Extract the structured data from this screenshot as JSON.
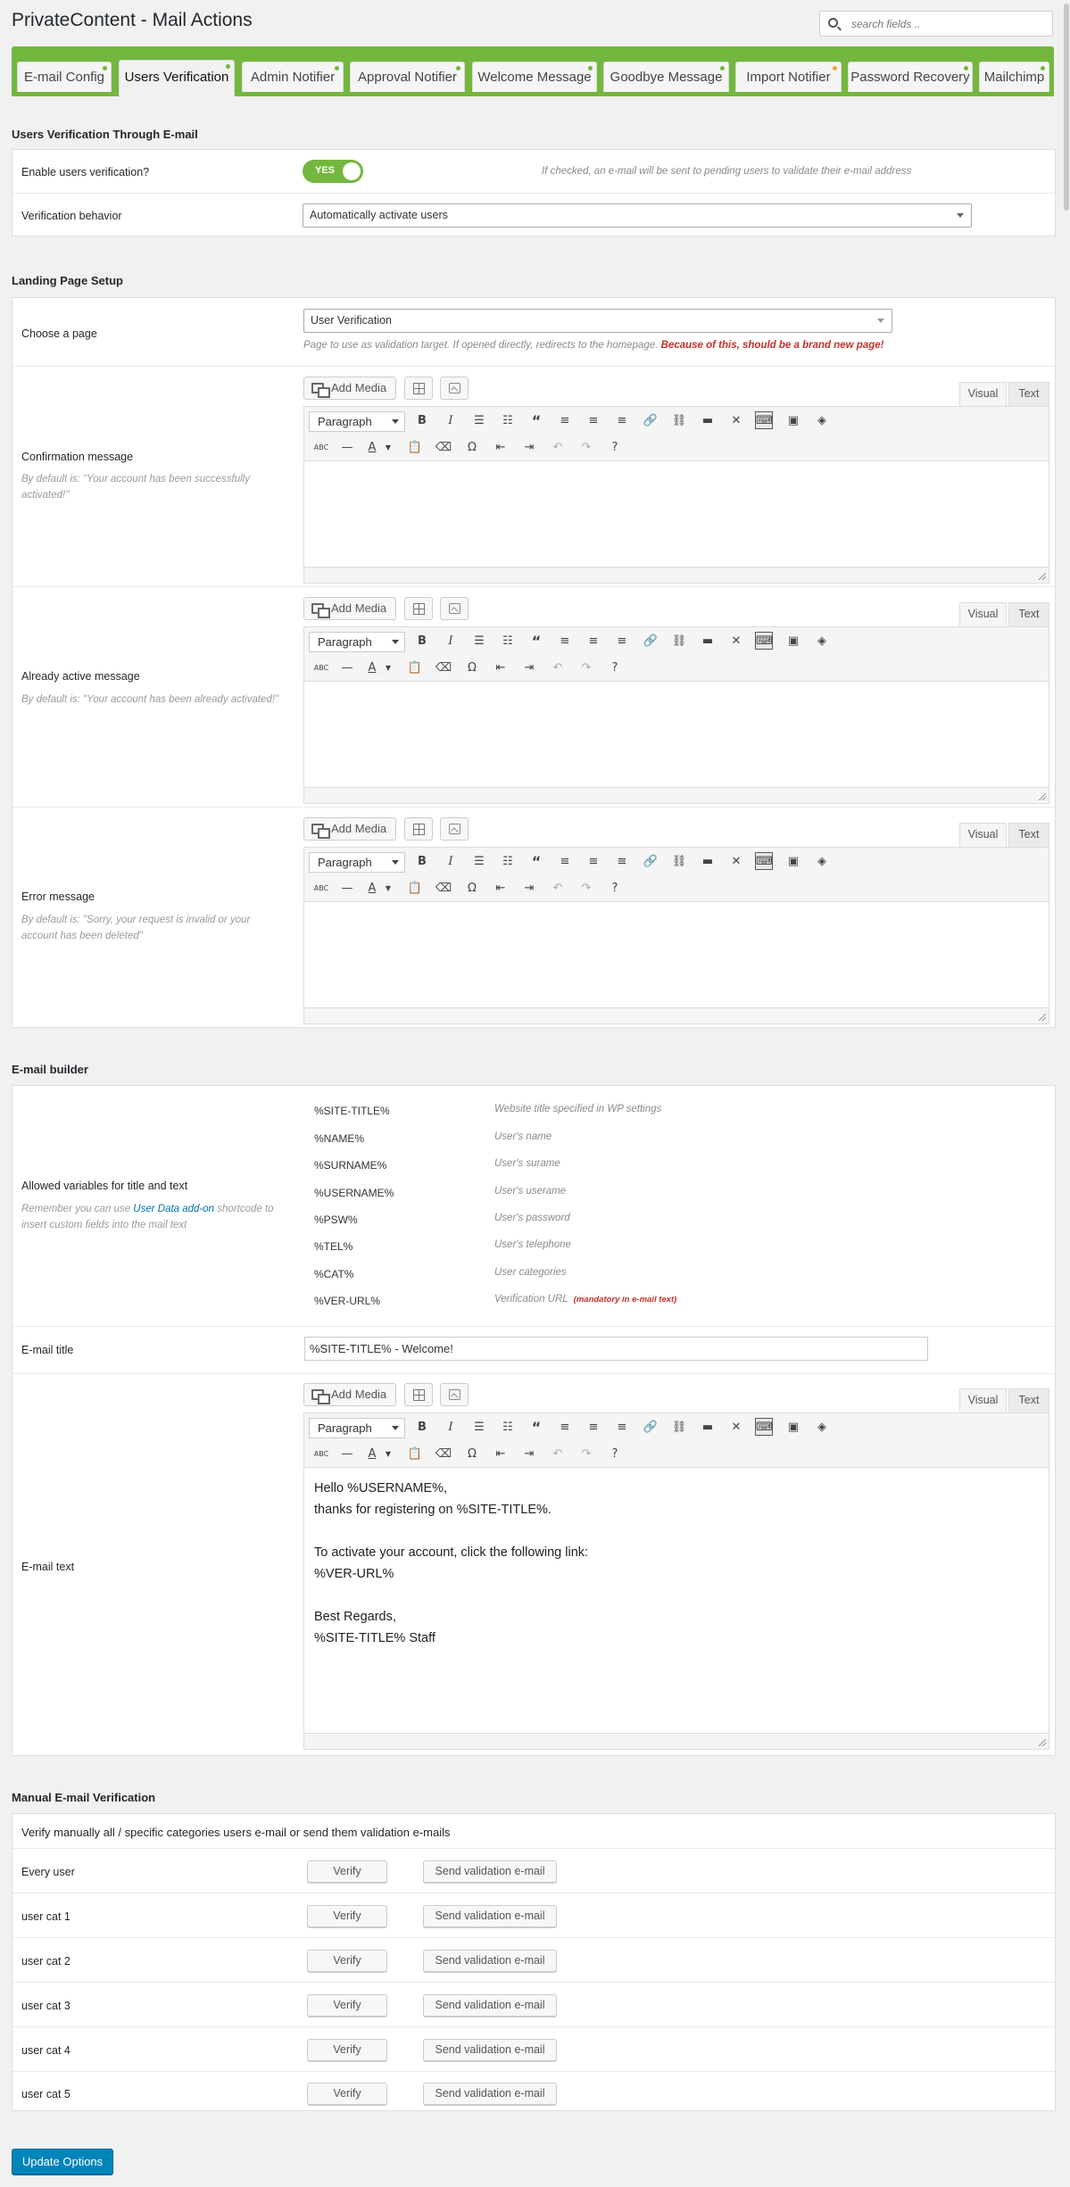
{
  "header": {
    "title": "PrivateContent - Mail Actions",
    "search_placeholder": "search fields .."
  },
  "tabs": [
    {
      "label": "E-mail Config"
    },
    {
      "label": "Users Verification"
    },
    {
      "label": "Admin Notifier"
    },
    {
      "label": "Approval Notifier"
    },
    {
      "label": "Welcome Message"
    },
    {
      "label": "Goodbye Message"
    },
    {
      "label": "Import Notifier"
    },
    {
      "label": "Password Recovery"
    },
    {
      "label": "Mailchimp"
    }
  ],
  "colors": {
    "tab_bar": "#73b73e",
    "toggle_on": "#73b73e",
    "warning_red": "#c4302b",
    "primary_button": "#0085ba",
    "link": "#0073aa"
  },
  "verification": {
    "title": "Users Verification Through E-mail",
    "enable_label": "Enable users verification?",
    "enable_toggle": "YES",
    "enable_note": "If checked, an e-mail will be sent to pending users to validate their e-mail address",
    "behavior_label": "Verification behavior",
    "behavior_value": "Automatically activate users"
  },
  "landing": {
    "title": "Landing Page Setup",
    "page_label": "Choose a page",
    "page_value": "User Verification",
    "page_note": "Page to use as validation target. If opened directly, redirects to the homepage.",
    "page_warning": "Because of this, should be a brand new page!",
    "confirm_label": "Confirmation message",
    "confirm_hint": "By default is: \"Your account has been successfully activated!\"",
    "active_label": "Already active message",
    "active_hint": "By default is: \"Your account has been already activated!\"",
    "error_label": "Error message",
    "error_hint": "By default is: \"Sorry, your request is invalid or your account has been deleted\""
  },
  "editor": {
    "add_media": "Add Media",
    "paragraph": "Paragraph",
    "visual": "Visual",
    "text": "Text"
  },
  "builder": {
    "title": "E-mail builder",
    "vars_label": "Allowed variables for title and text",
    "vars_hint_pre": "Remember you can use",
    "vars_hint_link": "User Data add-on",
    "vars_hint_post": "shortcode to insert custom fields into the mail text",
    "variables": [
      {
        "name": "%SITE-TITLE%",
        "desc": "Website title specified in WP settings"
      },
      {
        "name": "%NAME%",
        "desc": "User's name"
      },
      {
        "name": "%SURNAME%",
        "desc": "User's surame"
      },
      {
        "name": "%USERNAME%",
        "desc": "User's userame"
      },
      {
        "name": "%PSW%",
        "desc": "User's password"
      },
      {
        "name": "%TEL%",
        "desc": "User's telephone"
      },
      {
        "name": "%CAT%",
        "desc": "User categories"
      },
      {
        "name": "%VER-URL%",
        "desc": "Verification URL"
      }
    ],
    "mandatory_note": "(mandatory in e-mail text)",
    "title_label": "E-mail title",
    "title_value": "%SITE-TITLE% - Welcome!",
    "text_label": "E-mail text",
    "text_value": "Hello %USERNAME%,\nthanks for registering on %SITE-TITLE%.\n\nTo activate your account, click the following link:\n%VER-URL%\n\nBest Regards,\n%SITE-TITLE% Staff"
  },
  "manual": {
    "title": "Manual E-mail Verification",
    "intro": "Verify manually all / specific categories users e-mail or send them validation e-mails",
    "verify_label": "Verify",
    "send_label": "Send validation e-mail",
    "rows": [
      {
        "label": "Every user"
      },
      {
        "label": "user cat 1"
      },
      {
        "label": "user cat 2"
      },
      {
        "label": "user cat 3"
      },
      {
        "label": "user cat 4"
      },
      {
        "label": "user cat 5"
      }
    ]
  },
  "submit_label": "Update Options"
}
